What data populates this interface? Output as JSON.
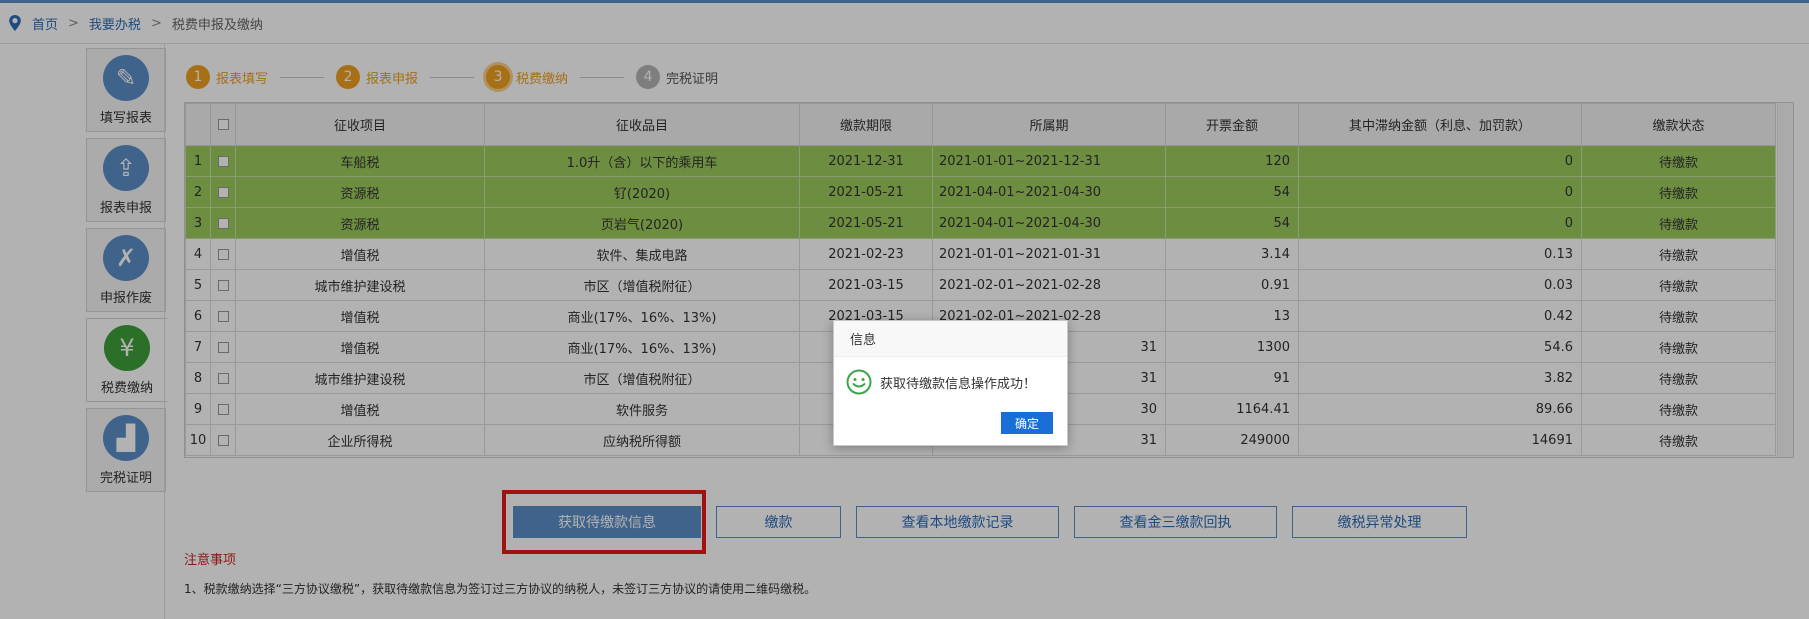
{
  "breadcrumb": {
    "home": "首页",
    "sep1": ">",
    "level2": "我要办税",
    "sep2": ">",
    "current": "税费申报及缴纳"
  },
  "sidenav": [
    {
      "label": "填写报表",
      "icon": "pencil-icon",
      "glyph": "✎"
    },
    {
      "label": "报表申报",
      "icon": "upload-doc-icon",
      "glyph": "⇪"
    },
    {
      "label": "申报作废",
      "icon": "void-doc-icon",
      "glyph": "✗"
    },
    {
      "label": "税费缴纳",
      "icon": "tax-pay-icon",
      "glyph": "¥"
    },
    {
      "label": "完税证明",
      "icon": "stamp-icon",
      "glyph": "▟"
    }
  ],
  "steps": [
    {
      "num": "1",
      "label": "报表填写"
    },
    {
      "num": "2",
      "label": "报表申报"
    },
    {
      "num": "3",
      "label": "税费缴纳"
    },
    {
      "num": "4",
      "label": "完税证明"
    }
  ],
  "table": {
    "headers": [
      "征收项目",
      "征收品目",
      "缴款期限",
      "所属期",
      "开票金额",
      "其中滞纳金额（利息、加罚款）",
      "缴款状态"
    ],
    "rows": [
      {
        "no": "1",
        "item": "车船税",
        "sub": "1.0升（含）以下的乘用车",
        "deadline": "2021-12-31",
        "period": "2021-01-01~2021-12-31",
        "amount": "120",
        "late": "0",
        "status": "待缴款"
      },
      {
        "no": "2",
        "item": "资源税",
        "sub": "钌(2020)",
        "deadline": "2021-05-21",
        "period": "2021-04-01~2021-04-30",
        "amount": "54",
        "late": "0",
        "status": "待缴款"
      },
      {
        "no": "3",
        "item": "资源税",
        "sub": "页岩气(2020)",
        "deadline": "2021-05-21",
        "period": "2021-04-01~2021-04-30",
        "amount": "54",
        "late": "0",
        "status": "待缴款"
      },
      {
        "no": "4",
        "item": "增值税",
        "sub": "软件、集成电路",
        "deadline": "2021-02-23",
        "period": "2021-01-01~2021-01-31",
        "amount": "3.14",
        "late": "0.13",
        "status": "待缴款"
      },
      {
        "no": "5",
        "item": "城市维护建设税",
        "sub": "市区（增值税附征）",
        "deadline": "2021-03-15",
        "period": "2021-02-01~2021-02-28",
        "amount": "0.91",
        "late": "0.03",
        "status": "待缴款"
      },
      {
        "no": "6",
        "item": "增值税",
        "sub": "商业(17%、16%、13%)",
        "deadline": "2021-03-15",
        "period": "2021-02-01~2021-02-28",
        "amount": "13",
        "late": "0.42",
        "status": "待缴款"
      },
      {
        "no": "7",
        "item": "增值税",
        "sub": "商业(17%、16%、13%)",
        "deadline": "",
        "period": "31",
        "amount": "1300",
        "late": "54.6",
        "status": "待缴款"
      },
      {
        "no": "8",
        "item": "城市维护建设税",
        "sub": "市区（增值税附征）",
        "deadline": "",
        "period": "31",
        "amount": "91",
        "late": "3.82",
        "status": "待缴款"
      },
      {
        "no": "9",
        "item": "增值税",
        "sub": "软件服务",
        "deadline": "",
        "period": "30",
        "amount": "1164.41",
        "late": "89.66",
        "status": "待缴款"
      },
      {
        "no": "10",
        "item": "企业所得税",
        "sub": "应纳税所得额",
        "deadline": "",
        "period": "31",
        "amount": "249000",
        "late": "14691",
        "status": "待缴款"
      }
    ]
  },
  "buttons": {
    "fetch": "获取待缴款信息",
    "pay": "缴款",
    "local_records": "查看本地缴款记录",
    "receipt": "查看金三缴款回执",
    "exception": "缴税异常处理"
  },
  "notes": {
    "title": "注意事项",
    "line1": "1、税款缴纳选择“三方协议缴税”，获取待缴款信息为签订过三方协议的纳税人，未签订三方协议的请使用二维码缴税。"
  },
  "dialog": {
    "title": "信息",
    "message": "获取待缴款信息操作成功！",
    "ok": "确定"
  },
  "colors": {
    "accent": "#5b8fc7",
    "highlight_row": "#9ccb5c",
    "step_done": "#f0a020",
    "alert_red": "#e61a1a"
  }
}
